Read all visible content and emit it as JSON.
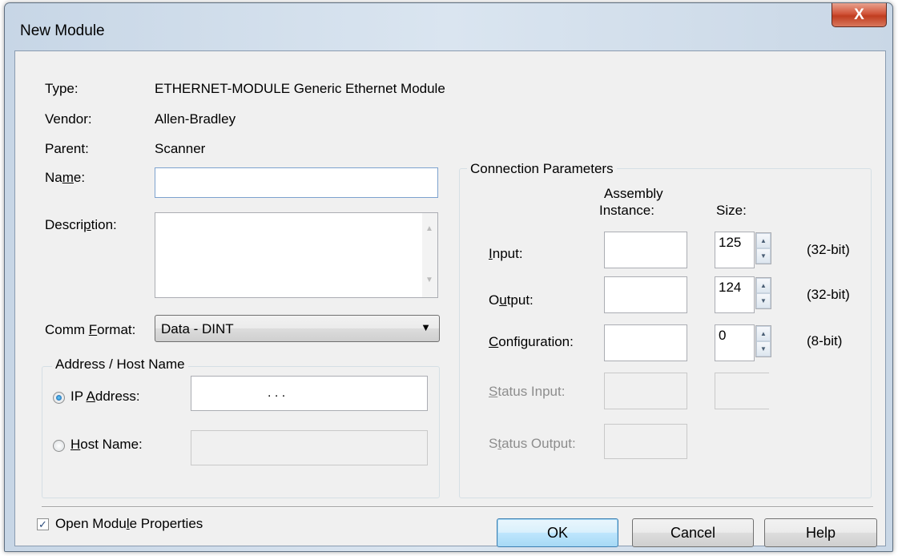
{
  "window": {
    "title": "New Module",
    "close_label": "X"
  },
  "info": {
    "type_label": "Type:",
    "type_value": "ETHERNET-MODULE Generic Ethernet Module",
    "vendor_label": "Vendor:",
    "vendor_value": "Allen-Bradley",
    "parent_label": "Parent:",
    "parent_value": "Scanner"
  },
  "name_field": {
    "label_pre": "Na",
    "label_key": "m",
    "label_post": "e:",
    "value": ""
  },
  "description_field": {
    "label_pre": "Descri",
    "label_key": "p",
    "label_post": "tion:",
    "value": ""
  },
  "comm_format": {
    "label_pre": "Comm ",
    "label_key": "F",
    "label_post": "ormat:",
    "selected": "Data - DINT"
  },
  "address_group": {
    "legend": "Address / Host Name",
    "ip_label_pre": "IP ",
    "ip_label_key": "A",
    "ip_label_post": "ddress:",
    "ip_dots": ".          .          .",
    "host_label_key": "H",
    "host_label_post": "ost Name:",
    "ip_selected": true
  },
  "connection": {
    "legend": "Connection Parameters",
    "col_assembly_line1": "Assembly",
    "col_assembly_line2": "Instance:",
    "col_size": "Size:",
    "rows": [
      {
        "label_key": "I",
        "label_post": "nput:",
        "size": "125",
        "unit": "(32-bit)"
      },
      {
        "label_pre": "O",
        "label_key": "u",
        "label_post": "tput:",
        "size": "124",
        "unit": "(32-bit)"
      },
      {
        "label_key": "C",
        "label_post": "onfiguration:",
        "size": "0",
        "unit": "(8-bit)"
      }
    ],
    "status_input_label_key": "S",
    "status_input_label_post": "tatus Input:",
    "status_output_label_pre": "S",
    "status_output_label_key": "t",
    "status_output_label_post": "atus Output:"
  },
  "footer": {
    "open_props_pre": "Open Modu",
    "open_props_key": "l",
    "open_props_post": "e Properties",
    "open_props_checked": true,
    "ok_label": "OK",
    "cancel_label": "Cancel",
    "help_label": "Help"
  }
}
